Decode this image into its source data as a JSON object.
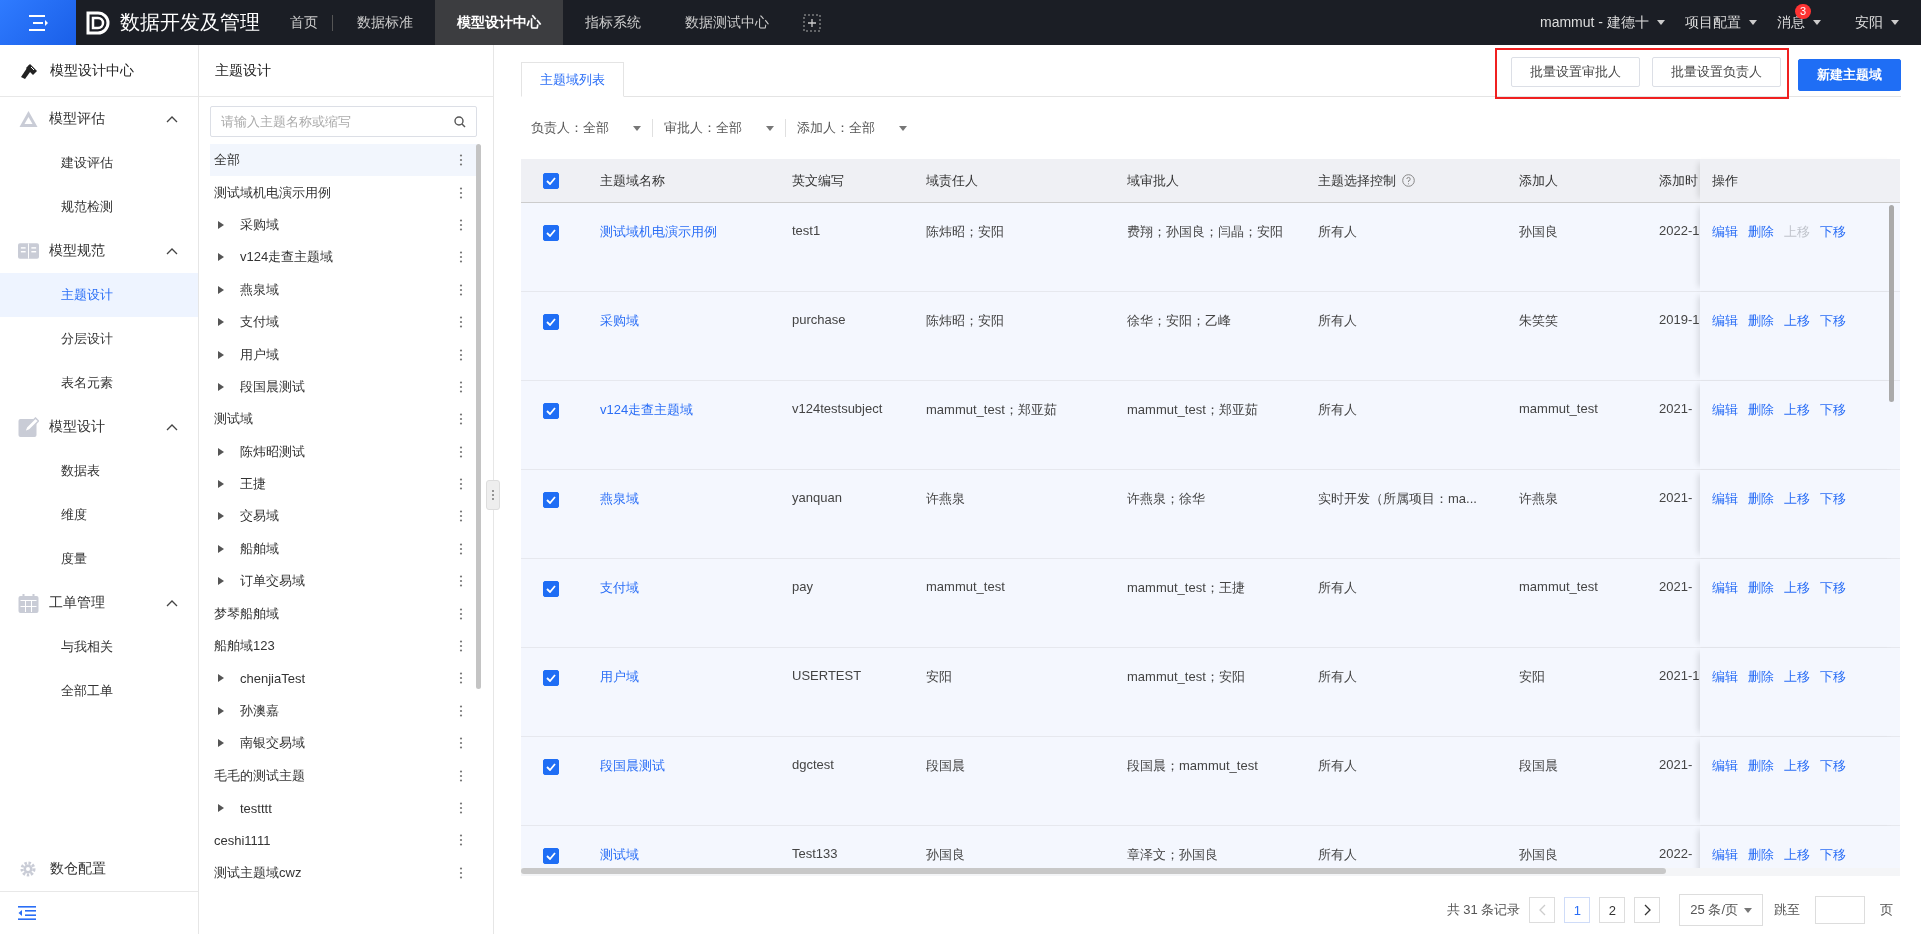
{
  "top_bar": {
    "app_title": "数据开发及管理",
    "nav": [
      {
        "label": "首页",
        "selected": false
      },
      {
        "label": "数据标准",
        "selected": false
      },
      {
        "label": "模型设计中心",
        "selected": true
      },
      {
        "label": "指标系统",
        "selected": false
      },
      {
        "label": "数据测试中心",
        "selected": false
      }
    ],
    "right_menus": [
      {
        "label": "mammut - 建德十"
      },
      {
        "label": "项目配置"
      },
      {
        "label": "消息",
        "badge": "3"
      },
      {
        "label": "安阳"
      }
    ]
  },
  "sidebar": {
    "title": "模型设计中心",
    "groups": [
      {
        "label": "模型评估",
        "expanded": true,
        "items": [
          {
            "label": "建设评估",
            "selected": false
          },
          {
            "label": "规范检测",
            "selected": false
          }
        ]
      },
      {
        "label": "模型规范",
        "expanded": true,
        "items": [
          {
            "label": "主题设计",
            "selected": true
          },
          {
            "label": "分层设计",
            "selected": false
          },
          {
            "label": "表名元素",
            "selected": false
          }
        ]
      },
      {
        "label": "模型设计",
        "expanded": true,
        "items": [
          {
            "label": "数据表",
            "selected": false
          },
          {
            "label": "维度",
            "selected": false
          },
          {
            "label": "度量",
            "selected": false
          }
        ]
      },
      {
        "label": "工单管理",
        "expanded": true,
        "items": [
          {
            "label": "与我相关",
            "selected": false
          },
          {
            "label": "全部工单",
            "selected": false
          }
        ]
      }
    ],
    "footer": "数仓配置"
  },
  "tree_panel": {
    "title": "主题设计",
    "search": {
      "placeholder": "请输入主题名称或缩写"
    },
    "items": [
      {
        "label": "全部",
        "selected": true
      },
      {
        "label": "测试域机电演示用例",
        "selected": false,
        "children": [
          {
            "label": "采购域",
            "selected": false,
            "expanded": false
          },
          {
            "label": "v124走查主题域",
            "selected": false,
            "expanded": false
          },
          {
            "label": "燕泉域",
            "selected": false,
            "expanded": false
          },
          {
            "label": "支付域",
            "selected": false,
            "expanded": false
          },
          {
            "label": "用户域",
            "selected": false,
            "expanded": false
          },
          {
            "label": "段国晨测试",
            "selected": false,
            "expanded": false
          }
        ]
      },
      {
        "label": "测试域",
        "selected": false,
        "children": [
          {
            "label": "陈炜昭测试",
            "selected": false,
            "expanded": false
          },
          {
            "label": "王捷",
            "selected": false,
            "expanded": false
          },
          {
            "label": "交易域",
            "selected": false,
            "expanded": false
          },
          {
            "label": "船舶域",
            "selected": false,
            "expanded": false
          },
          {
            "label": "订单交易域",
            "selected": false,
            "expanded": false
          }
        ]
      },
      {
        "label": "梦琴船舶域",
        "selected": false
      },
      {
        "label": "船舶域123",
        "selected": false,
        "children": [
          {
            "label": "chenjiaTest",
            "selected": false,
            "expanded": false
          },
          {
            "label": "孙澳嘉",
            "selected": false,
            "expanded": false
          },
          {
            "label": "南银交易域",
            "selected": false,
            "expanded": false
          }
        ]
      },
      {
        "label": "毛毛的测试主题",
        "selected": false,
        "children": [
          {
            "label": "testttt",
            "selected": false,
            "expanded": false
          }
        ]
      },
      {
        "label": "ceshi1111",
        "selected": false
      },
      {
        "label": "测试主题域cwz",
        "selected": false
      }
    ]
  },
  "main": {
    "tabs": [
      {
        "label": "主题域列表",
        "selected": true
      }
    ],
    "button_groups": [
      {
        "highlighted": true,
        "buttons": [
          {
            "label": "批量设置审批人",
            "kind": "default"
          },
          {
            "label": "批量设置负责人",
            "kind": "default"
          }
        ]
      },
      {
        "highlighted": false,
        "buttons": [
          {
            "label": "新建主题域",
            "kind": "primary"
          }
        ]
      }
    ],
    "filters": [
      {
        "label": "负责人：全部"
      },
      {
        "label": "审批人：全部"
      },
      {
        "label": "添加人：全部"
      }
    ],
    "table": {
      "all_checked": true,
      "columns": [
        {
          "label": "主题域名称",
          "help": false
        },
        {
          "label": "英文编写",
          "help": false
        },
        {
          "label": "域责任人",
          "help": false
        },
        {
          "label": "域审批人",
          "help": false
        },
        {
          "label": "主题选择控制",
          "help": true
        },
        {
          "label": "添加人",
          "help": false
        },
        {
          "label": "添加时",
          "help": false
        },
        {
          "label": "操作",
          "help": false
        }
      ],
      "rows": [
        {
          "checked": true,
          "cells": [
            "测试域机电演示用例",
            "test1",
            "陈炜昭；安阳",
            "费翔；孙国良；闫晶；安阳",
            "所有人",
            "孙国良",
            "2022-1"
          ],
          "actions": [
            {
              "label": "编辑",
              "disabled": false
            },
            {
              "label": "删除",
              "disabled": false
            },
            {
              "label": "上移",
              "disabled": true
            },
            {
              "label": "下移",
              "disabled": false
            }
          ]
        },
        {
          "checked": true,
          "cells": [
            "采购域",
            "purchase",
            "陈炜昭；安阳",
            "徐华；安阳；乙峰",
            "所有人",
            "朱笑笑",
            "2019-1"
          ],
          "actions": [
            {
              "label": "编辑",
              "disabled": false
            },
            {
              "label": "删除",
              "disabled": false
            },
            {
              "label": "上移",
              "disabled": false
            },
            {
              "label": "下移",
              "disabled": false
            }
          ]
        },
        {
          "checked": true,
          "cells": [
            "v124走查主题域",
            "v124testsubject",
            "mammut_test；郑亚茹",
            "mammut_test；郑亚茹",
            "所有人",
            "mammut_test",
            "2021-"
          ],
          "actions": [
            {
              "label": "编辑",
              "disabled": false
            },
            {
              "label": "删除",
              "disabled": false
            },
            {
              "label": "上移",
              "disabled": false
            },
            {
              "label": "下移",
              "disabled": false
            }
          ]
        },
        {
          "checked": true,
          "cells": [
            "燕泉域",
            "yanquan",
            "许燕泉",
            "许燕泉；徐华",
            "实时开发（所属项目：ma...",
            "许燕泉",
            "2021-"
          ],
          "actions": [
            {
              "label": "编辑",
              "disabled": false
            },
            {
              "label": "删除",
              "disabled": false
            },
            {
              "label": "上移",
              "disabled": false
            },
            {
              "label": "下移",
              "disabled": false
            }
          ]
        },
        {
          "checked": true,
          "cells": [
            "支付域",
            "pay",
            "mammut_test",
            "mammut_test；王捷",
            "所有人",
            "mammut_test",
            "2021-"
          ],
          "actions": [
            {
              "label": "编辑",
              "disabled": false
            },
            {
              "label": "删除",
              "disabled": false
            },
            {
              "label": "上移",
              "disabled": false
            },
            {
              "label": "下移",
              "disabled": false
            }
          ]
        },
        {
          "checked": true,
          "cells": [
            "用户域",
            "USERTEST",
            "安阳",
            "mammut_test；安阳",
            "所有人",
            "安阳",
            "2021-1"
          ],
          "actions": [
            {
              "label": "编辑",
              "disabled": false
            },
            {
              "label": "删除",
              "disabled": false
            },
            {
              "label": "上移",
              "disabled": false
            },
            {
              "label": "下移",
              "disabled": false
            }
          ]
        },
        {
          "checked": true,
          "cells": [
            "段国晨测试",
            "dgctest",
            "段国晨",
            "段国晨；mammut_test",
            "所有人",
            "段国晨",
            "2021-"
          ],
          "actions": [
            {
              "label": "编辑",
              "disabled": false
            },
            {
              "label": "删除",
              "disabled": false
            },
            {
              "label": "上移",
              "disabled": false
            },
            {
              "label": "下移",
              "disabled": false
            }
          ]
        },
        {
          "checked": true,
          "cells": [
            "测试域",
            "Test133",
            "孙国良",
            "章泽文；孙国良",
            "所有人",
            "孙国良",
            "2022-"
          ],
          "actions": [
            {
              "label": "编辑",
              "disabled": false
            },
            {
              "label": "删除",
              "disabled": false
            },
            {
              "label": "上移",
              "disabled": false
            },
            {
              "label": "下移",
              "disabled": false
            }
          ]
        }
      ]
    },
    "pagination": {
      "total": "共 31 条记录",
      "pages": [
        {
          "label": "1",
          "selected": true
        },
        {
          "label": "2",
          "selected": false
        }
      ],
      "page_size": "25 条/页",
      "jump_label": "跳至",
      "page_unit": "页"
    }
  }
}
